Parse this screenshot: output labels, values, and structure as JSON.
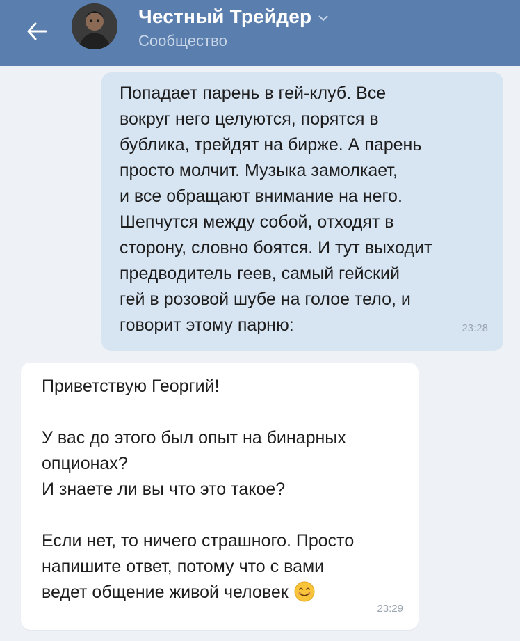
{
  "header": {
    "title": "Честный Трейдер",
    "subtitle": "Сообщество",
    "icons": {
      "back": "arrow-left-icon",
      "dropdown": "chevron-down-icon"
    }
  },
  "messages": {
    "outgoing": {
      "lines": [
        "Попадает парень в гей-клуб. Все",
        "вокруг него целуются, порятся в",
        "бублика, трейдят на бирже. А парень",
        "просто молчит. Музыка замолкает,",
        "и все обращают внимание на него.",
        "Шепчутся между собой, отходят в",
        "сторону, словно боятся. И тут выходит",
        "предводитель геев, самый гейский",
        "гей в розовой шубе на голое тело, и",
        "говорит этому парню:"
      ],
      "time": "23:28"
    },
    "incoming": {
      "lines": [
        "Приветствую Георгий!",
        "",
        "У вас до этого был опыт на бинарных",
        "опционах?",
        "И знаете ли вы что это такое?",
        "",
        "Если нет, то ничего страшного. Просто",
        "напишите ответ, потому что с вами",
        "ведет общение живой человек"
      ],
      "emoji": "smiling-face-emoji",
      "time": "23:29"
    }
  },
  "colors": {
    "header_bg": "#5a7fae",
    "page_bg": "#eef2f6",
    "outgoing_bubble": "#d7e4f2",
    "incoming_bubble": "#ffffff"
  }
}
